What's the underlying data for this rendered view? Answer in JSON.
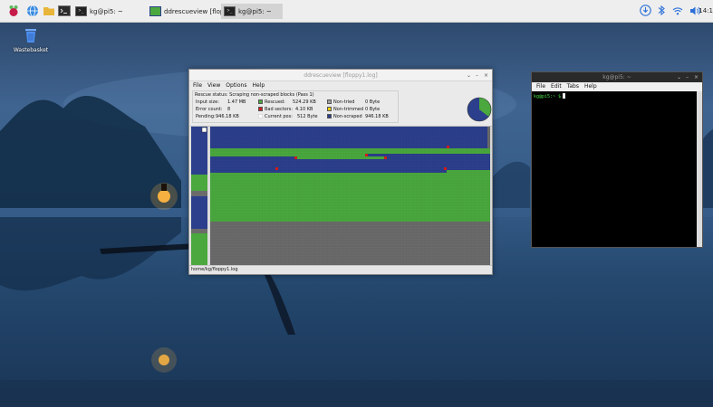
{
  "taskbar": {
    "tasks": [
      {
        "label": "kg@pi5: ~"
      },
      {
        "label": "ddrescueview [floppy..."
      },
      {
        "label": "kg@pi5: ~"
      }
    ],
    "clock": "14:1"
  },
  "desktop": {
    "icons": [
      {
        "label": "Wastebasket"
      }
    ]
  },
  "ddrescueview": {
    "title": "ddrescueview [floppy1.log]",
    "menu": [
      "File",
      "View",
      "Options",
      "Help"
    ],
    "rescue_status": "Rescue status:  Scraping non-scraped blocks (Pass 1)",
    "fields": {
      "input_size_label": "Input size:",
      "input_size": "1.47 MB",
      "error_count_label": "Error count:",
      "error_count": "8",
      "pending_label": "Pending:",
      "pending": "946.18 KB",
      "rescued_label": "Rescued:",
      "rescued": "524.29 KB",
      "bad_sectors_label": "Bad sectors:",
      "bad_sectors": "4.10 KB",
      "current_pos_label": "Current pos:",
      "current_pos": "512 Byte",
      "non_tried_label": "Non-tried",
      "non_tried": "0 Byte",
      "non_trimmed_label": "Non-trimmed",
      "non_trimmed": "0 Byte",
      "non_scraped_label": "Non-scraped",
      "non_scraped": "946.18 KB"
    },
    "progress": {
      "rescued_fraction": 0.354,
      "non_scraped_fraction": 0.643,
      "bad_fraction": 0.003
    },
    "block_rows": [
      "nnnnnnnnnnnnnnnnnnnnnnnnnnnnnnnnnnnnnnnnnnnnnnnnnnnnnnnnnnnnnnnnnnnnnnnnnnnnnnnnnnnnnnnnnnnnnnnnnnnnnn",
      "nnnnnnnnnnnnnnnnnnnnnnnnnnnnnnnnnnnnnnnnnnnnnnnnnnnnnnnnnnnnnnnnnnnnnnnnnnnnnnnnnnnnnnnnnnnnnnnnnnnnnn",
      "nnnnnnnnnnnnnnnnnnnnnnnnnnnnnnnnnnnnnnnnnnnnnnnnnnnnnnnnnnnnnnnnnnnnnnnnnnnnnnnnnnnnnnnnnnnnnnnnnnnnnn",
      "nnnnnnnnnnnnnnnnnnnnnnnnnnnnnnnnnnnnnnnnnnnnnnnnnnnnnnnnnnnnnnnnnnnnnnnnnnnnnnnnnnnnnnnnnnnnnnnnnnnnnn",
      "nnnnnnnnnnnnnnnnnnnnnnnnnnnnnnnnnnnnnnnnnnnnnnnnnnnnnnnnnnnnnnnnnnnnnnnnnnnnnnnnnnnnnnnnnnnnnnnnnnnnnn",
      "nnnnnnnnnnnnnnnnnnnnnnnnnnnnnnnnnnnnnnnnnnnnnnnnnnnnnnnnnnnnnnnnnnnnnnnnnnnnnnnnnnnnnnnnnnnnnnnnnnnnnn",
      "nnnnnnnnnnnnnnnnnnnnnnnnnnnnnnnnnnnnnnnnnnnnnnnnnnnnnnnnnnnnnnnnnnnnnnnnnnnnnnnnnnnnnnnnnnnnnnnnnnnnnn",
      "nnnnnnnnnnnnnnnnnnnnnnnnnnnnnnnnnnnnnnnnnnnnnnnnnnnnnnnnnnnnnnnnnnnnnnnnnnnnnnnnnnnnnnnbnnnnnnnnnnnnnn",
      "rrrrrrrrrrrrrrrrrrrrrrrrrrrrrrrrrrrrrrrrrrrrrrrrrrrrrrrrrrrrrrrrrrrrrrrrrrrrrrrrrrrrrrrrrrrrrrrrrrrrrrr",
      "rrrrrrrrrrrrrrrrrrrrrrrrrrrrrrrrrrrrrrrrrrrrrrrrrrrrrrrrrrrrrrrrrrrrrrrrrrrrrrrrrrrrrrrrrrrrrrrrrrrrrrr",
      "rrrrrrrrrrrrrrrrrrrrrrrrrrrrrrrrrrrrrrrrrrrrrrrrrrrrrrrrrbnnnnnnnnnnnnnnnnnnnnnnnnnnnnnnnnnnnnnnnnnnnnn",
      "nnnnnnnnnnnnnnnnnnnnnnnnnnnnnnnbrrrrrrrrrrrrrrrrrrrrrrrrrrrrrrrrbnnnnnnnnnnnnnnnnnnnnnnnnnnnnnnnnnnnnnn",
      "nnnnnnnnnnnnnnnnnnnnnnnnnnnnnnnnnnnnnnnnnnnnnnnnnnnnnnnnnnnnnnnnnnnnnnnnnnnnnnnnnnnnnnnnnnnnnnnnnnnnnnn",
      "nnnnnnnnnnnnnnnnnnnnnnnnnnnnnnnnnnnnnnnnnnnnnnnnnnnnnnnnnnnnnnnnnnnnnnnnnnnnnnnnnnnnnnnnnnnnnnnnnnnnnnn",
      "nnnnnnnnnnnnnnnnnnnnnnnnnnnnnnnnnnnnnnnnnnnnnnnnnnnnnnnnnnnnnnnnnnnnnnnnnnnnnnnnnnnnnnnnnnnnnnnnnnnnnnn",
      "nnnnnnnnnnnnnnnnnnnnnnnnbnnnnnnnnnnnnnnnnnnnnnnnnnnnnnnnnnnnnnnnnnnnnnnnnnnnnnnnnnnnnnbnnnnnnnnnnnnnnnn",
      "nnnnnnnnnnnnnnnnnnnnnnnnnnnnnnnnnnnnnnnnnnnnnnnnnnnnnnnnnnnnnnnnnnnnnnnnnnnnnnnnnnnnnnnrrrrrrrrrrrrrrrr",
      "rrrrrrrrrrrrrrrrrrrrrrrrrrrrrrrrrrrrrrrrrrrrrrrrrrrrrrrrrrrrrrrrrrrrrrrrrrrrrrrrrrrrrrrrrrrrrrrrrrrrrrr",
      "rrrrrrrrrrrrrrrrrrrrrrrrrrrrrrrrrrrrrrrrrrrrrrrrrrrrrrrrrrrrrrrrrrrrrrrrrrrrrrrrrrrrrrrrrrrrrrrrrrrrrrr",
      "rrrrrrrrrrrrrrrrrrrrrrrrrrrrrrrrrrrrrrrrrrrrrrrrrrrrrrrrrrrrrrrrrrrrrrrrrrrrrrrrrrrrrrrrrrrrrrrrrrrrrrr",
      "rrrrrrrrrrrrrrrrrrrrrrrrrrrrrrrrrrrrrrrrrrrrrrrrrrrrrrrrrrrrrrrrrrrrrrrrrrrrrrrrrrrrrrrrrrrrrrrrrrrrrrr",
      "rrrrrrrrrrrrrrrrrrrrrrrrrrrrrrrrrrrrrrrrrrrrrrrrrrrrrrrrrrrrrrrrrrrrrrrrrrrrrrrrrrrrrrrrrrrrrrrrrrrrrrr",
      "rrrrrrrrrrrrrrrrrrrrrrrrrrrrrrrrrrrrrrrrrrrrrrrrrrrrrrrrrrrrrrrrrrrrrrrrrrrrrrrrrrrrrrrrrrrrrrrrrrrrrrr",
      "rrrrrrrrrrrrrrrrrrrrrrrrrrrrrrrrrrrrrrrrrrrrrrrrrrrrrrrrrrrrrrrrrrrrrrrrrrrrrrrrrrrrrrrrrrrrrrrrrrrrrrr",
      "rrrrrrrrrrrrrrrrrrrrrrrrrrrrrrrrrrrrrrrrrrrrrrrrrrrrrrrrrrrrrrrrrrrrrrrrrrrrrrrrrrrrrrrrrrrrrrrrrrrrrrr",
      "rrrrrrrrrrrrrrrrrrrrrrrrrrrrrrrrrrrrrrrrrrrrrrrrrrrrrrrrrrrrrrrrrrrrrrrrrrrrrrrrrrrrrrrrrrrrrrrrrrrrrrr",
      "rrrrrrrrrrrrrrrrrrrrrrrrrrrrrrrrrrrrrrrrrrrrrrrrrrrrrrrrrrrrrrrrrrrrrrrrrrrrrrrrrrrrrrrrrrrrrrrrrrrrrrr",
      "rrrrrrrrrrrrrrrrrrrrrrrrrrrrrrrrrrrrrrrrrrrrrrrrrrrrrrrrrrrrrrrrrrrrrrrrrrrrrrrrrrrrrrrrrrrrrrrrrrrrrrr",
      "rrrrrrrrrrrrrrrrrrrrrrrrrrrrrrrrrrrrrrrrrrrrrrrrrrrrrrrrrrrrrrrrrrrrrrrrrrrrrrrrrrrrrrrrrrrrrrrrrrrrrrr",
      "rrrrrrrrrrrrrrrrrrrrrrrrrrrrrrrrrrrrrrrrrrrrrrrrrrrrrrrrrrrrrrrrrrrrrrrrrrrrrrrrrrrrrrrrrrrrrrrrrrrrrrr",
      "rrrrrrrrrrrrrrrrrrrrrrrrrrrrrrrrrrrrrrrrrrrrrrrrrrrrrrrrrrrrrrrrrrrrrrrrrrrrrrrrrrrrrrrrrrrrrrrrrrrrrrr",
      "rrrrrrrrrrrrrrrrrrrrrrrrrrrrrrrrrrrrrrrrrrrrrrrrrrrrrrrrrrrrrrrrrrrrrrrrrrrrrrrrrrrrrrrrrrrrrrrrrrrrrrr",
      "rrrrrrrrrrrrrrrrrrrrrrrrrrrrrrrrrrrrrrrrrrrrrrrrrrrrrrrrrrrrrrrrrrrrrrrrrrrrrrrrrrrrrrrrrrrrrrrrrrrrrrr",
      "rrrrrrrrrrrrrrrrrrrrrrrrrrrrrrrrrrrrrrrrrrrrrrrrrrrrrrrrrrrrrrrrrrrrrrrrrrrrrrrrrrrrrrrrrrrrrrrrrrrrrrr",
      "rrrrrrrrrrrrrrrrrrrrrrrrrrrrrrrrrrrrrrrrrrrrrrrrrrrrrrrrrrrrrrrrrrrrrrrrrrrrrrrrrrrrrrrrrrrrrrrrrrrrrrr"
    ],
    "cell_colors": {
      "n": "#2c3f8c",
      "r": "#4aa83e",
      "b": "#d41c1c",
      "u": "#6b6b6b"
    },
    "statusbar": "home/kg/floppy1.log"
  },
  "terminal": {
    "title": "kg@pi5: ~",
    "menu": [
      "File",
      "Edit",
      "Tabs",
      "Help"
    ],
    "prompt": "kg@pi5:~ $"
  },
  "colors": {
    "rescued": "#4aa83e",
    "bad_sectors": "#d41c1c",
    "non_tried": "#9e9e9e",
    "non_trimmed": "#f0d000",
    "non_scraped": "#2c3f8c",
    "unused": "#6b6b6b"
  },
  "icons": [
    "raspberry-icon",
    "globe-icon",
    "folder-icon",
    "terminal-icon",
    "download-icon",
    "bluetooth-icon",
    "wifi-icon",
    "volume-icon",
    "trash-icon"
  ]
}
